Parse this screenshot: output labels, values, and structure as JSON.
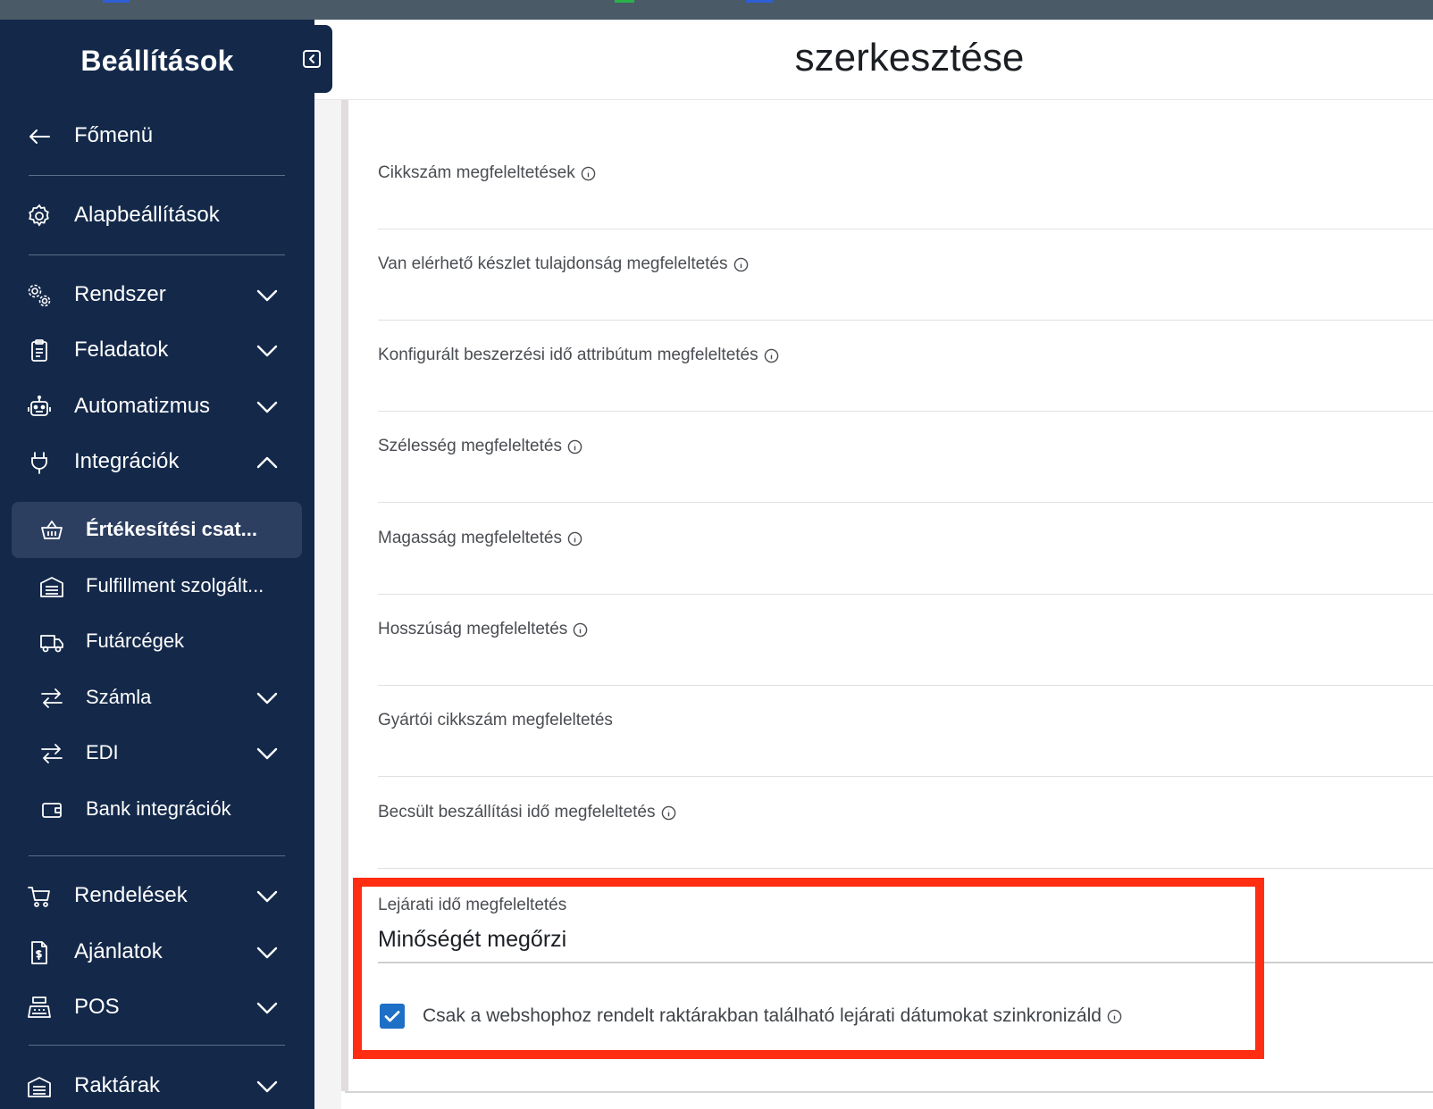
{
  "sidebar": {
    "title": "Beállítások",
    "items": [
      {
        "label": "Főmenü"
      },
      {
        "label": "Alapbeállítások"
      },
      {
        "label": "Rendszer"
      },
      {
        "label": "Feladatok"
      },
      {
        "label": "Automatizmus"
      },
      {
        "label": "Integrációk"
      },
      {
        "label": "Értékesítési csat..."
      },
      {
        "label": "Fulfillment szolgált..."
      },
      {
        "label": "Futárcégek"
      },
      {
        "label": "Számla"
      },
      {
        "label": "EDI"
      },
      {
        "label": "Bank integrációk"
      },
      {
        "label": "Rendelések"
      },
      {
        "label": "Ajánlatok"
      },
      {
        "label": "POS"
      },
      {
        "label": "Raktárak"
      }
    ]
  },
  "header": {
    "title": "szerkesztése"
  },
  "fields": [
    {
      "label": "Cikkszám megfeleltetések"
    },
    {
      "label": "Van elérhető készlet tulajdonság megfeleltetés"
    },
    {
      "label": "Konfigurált beszerzési idő attribútum megfeleltetés"
    },
    {
      "label": "Szélesség megfeleltetés"
    },
    {
      "label": "Magasság megfeleltetés"
    },
    {
      "label": "Hosszúság megfeleltetés"
    },
    {
      "label": "Gyártói cikkszám megfeleltetés"
    },
    {
      "label": "Becsült beszállítási idő megfeleltetés"
    }
  ],
  "expiry": {
    "label": "Lejárati idő megfeleltetés",
    "value": "Minőségét megőrzi",
    "checkbox_label": "Csak a webshophoz rendelt raktárakban található lejárati dátumokat szinkronizáld",
    "checked": true
  },
  "colors": {
    "sidebar_bg": "#14294a",
    "active_item_bg": "#2c3f61",
    "highlight": "#ff2d11",
    "checkbox": "#1e6fc6"
  }
}
